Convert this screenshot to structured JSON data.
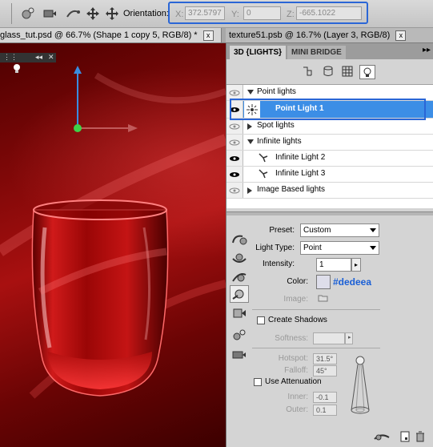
{
  "options_bar": {
    "orientation_label": "Orientation:",
    "x_label": "X:",
    "x_value": "372.5797",
    "y_label": "Y:",
    "y_value": "0",
    "z_label": "Z:",
    "z_value": "-665.1022"
  },
  "document_tabs": [
    {
      "label": "glass_tut.psd @ 66.7% (Shape 1 copy 5, RGB/8) *",
      "close": "x"
    },
    {
      "label": "texture51.psb @ 16.7% (Layer 3, RGB/8)",
      "close": "x"
    }
  ],
  "panel": {
    "tabs": [
      "3D {LIGHTS}",
      "MINI BRIDGE"
    ],
    "menu_icon": "panel-menu-arrows",
    "lights": [
      {
        "label": "Point lights",
        "type": "group"
      },
      {
        "label": "Point Light 1",
        "type": "item",
        "selected": true
      },
      {
        "label": "Spot lights",
        "type": "group"
      },
      {
        "label": "Infinite lights",
        "type": "group"
      },
      {
        "label": "Infinite Light 2",
        "type": "item"
      },
      {
        "label": "Infinite Light 3",
        "type": "item"
      },
      {
        "label": "Image Based lights",
        "type": "group"
      }
    ]
  },
  "properties": {
    "preset_label": "Preset:",
    "preset_value": "Custom",
    "light_type_label": "Light Type:",
    "light_type_value": "Point",
    "intensity_label": "Intensity:",
    "intensity_value": "1",
    "color_label": "Color:",
    "color_value": "#dedeea",
    "color_hex_text": "#dedeea",
    "image_label": "Image:",
    "create_shadows_label": "Create Shadows",
    "softness_label": "Softness:",
    "hotspot_label": "Hotspot:",
    "hotspot_value": "31.5°",
    "falloff_label": "Falloff:",
    "falloff_value": "45°",
    "use_attenuation_label": "Use Attenuation",
    "inner_label": "Inner:",
    "inner_value": "-0.1",
    "outer_label": "Outer:",
    "outer_value": "0.1"
  },
  "colors": {
    "accent": "#2a66d6",
    "selection": "#3c8ee6",
    "color_text": "#1a5fd6",
    "canvas_red": "#8a0a0a"
  }
}
